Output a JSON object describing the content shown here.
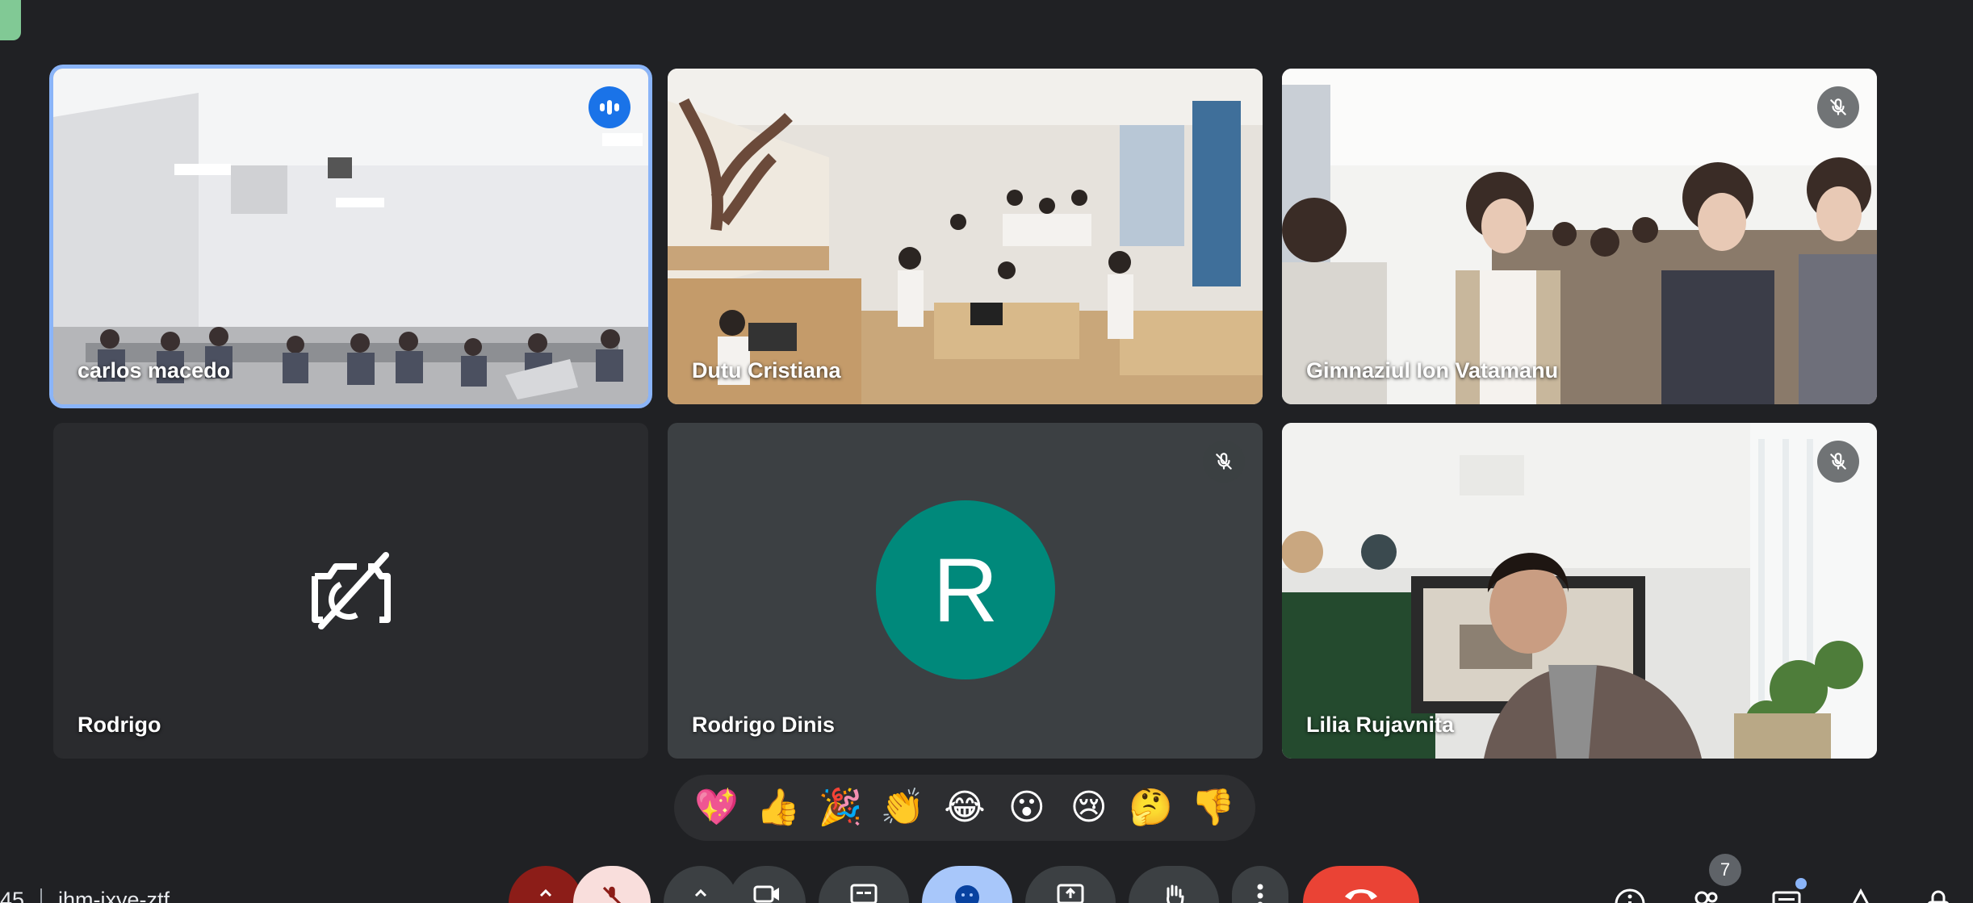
{
  "participants": [
    {
      "name": "carlos macedo",
      "status": "speaking"
    },
    {
      "name": "Dutu Cristiana",
      "status": "video"
    },
    {
      "name": "Gimnaziul Ion Vatamanu",
      "status": "muted"
    },
    {
      "name": "Rodrigo",
      "status": "camera-off"
    },
    {
      "name": "Rodrigo Dinis",
      "status": "muted",
      "avatar_letter": "R",
      "avatar_color": "#00897b"
    },
    {
      "name": "Lilia Rujavnita",
      "status": "muted"
    }
  ],
  "reactions": [
    {
      "emoji": "💖",
      "icon": "sparkling-heart-icon"
    },
    {
      "emoji": "👍",
      "icon": "thumbs-up-icon"
    },
    {
      "emoji": "🎉",
      "icon": "party-popper-icon"
    },
    {
      "emoji": "👏",
      "icon": "clapping-hands-icon"
    },
    {
      "emoji": "😂",
      "icon": "tears-of-joy-icon"
    },
    {
      "emoji": "😮",
      "icon": "surprised-face-icon"
    },
    {
      "emoji": "😢",
      "icon": "crying-face-icon"
    },
    {
      "emoji": "🤔",
      "icon": "thinking-face-icon"
    },
    {
      "emoji": "👎",
      "icon": "thumbs-down-icon"
    }
  ],
  "meeting": {
    "time": "45",
    "code": "ihm-ixye-ztf"
  },
  "people_count": "7",
  "colors": {
    "background": "#202124",
    "active_border": "#8ab4f8",
    "speaking_indicator": "#1a73e8",
    "end_call": "#ea4335"
  }
}
